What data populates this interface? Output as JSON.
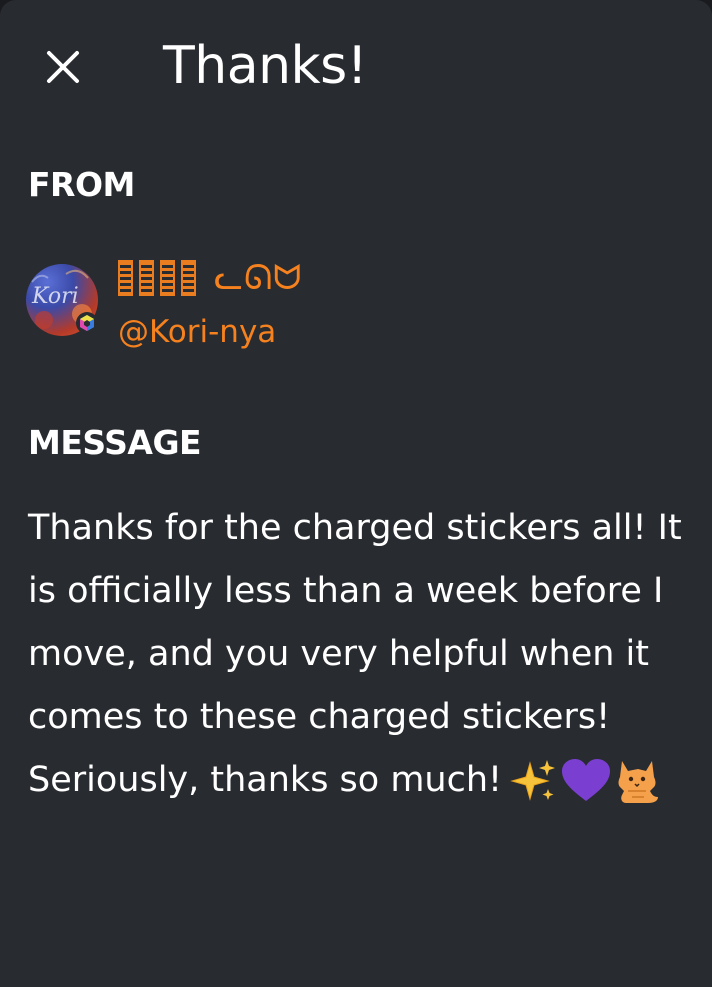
{
  "dialog": {
    "title": "Thanks!",
    "close_icon": "close-icon"
  },
  "from": {
    "label": "FROM",
    "display_name_tail": "ᓚᘏᗢ",
    "username": "@Kori-nya",
    "avatar_text": "Kori",
    "badge_icon": "nitro-hex-badge-icon"
  },
  "message": {
    "label": "MESSAGE",
    "text": "Thanks for the charged stickers all! It is officially less than a week before I move, and you very helpful when it comes to these charged stickers! Seriously, thanks so much!",
    "emojis": [
      "sparkles-icon",
      "purple-heart-icon",
      "cat-icon"
    ]
  },
  "colors": {
    "background": "#282b30",
    "accent_orange": "#f5821f",
    "text": "#ffffff"
  }
}
